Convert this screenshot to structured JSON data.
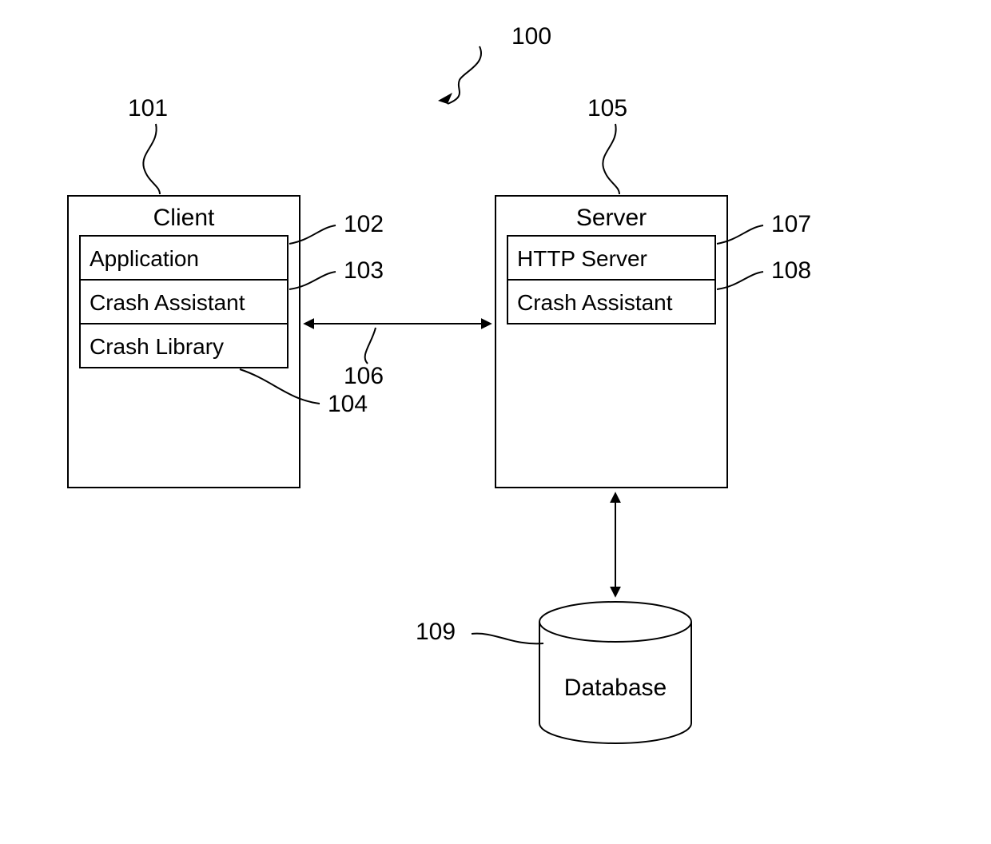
{
  "refs": {
    "system": "100",
    "client": "101",
    "application": "102",
    "crash_assistant_client": "103",
    "crash_library": "104",
    "server": "105",
    "link": "106",
    "http_server": "107",
    "crash_assistant_server": "108",
    "database": "109"
  },
  "labels": {
    "client_title": "Client",
    "application": "Application",
    "crash_assistant": "Crash Assistant",
    "crash_library": "Crash Library",
    "server_title": "Server",
    "http_server": "HTTP Server",
    "database": "Database"
  }
}
